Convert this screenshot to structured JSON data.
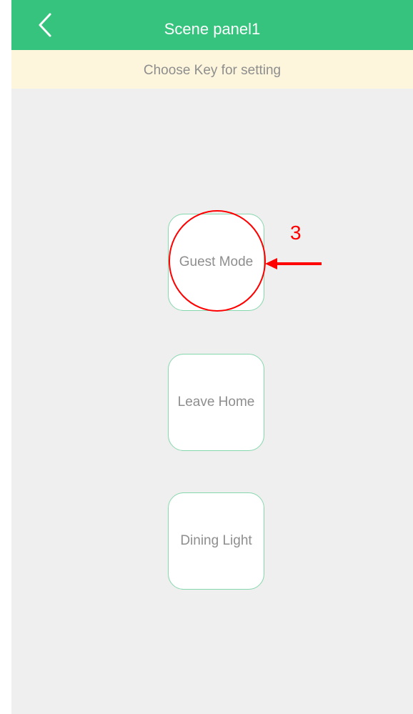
{
  "header": {
    "title": "Scene panel1",
    "back_icon": "chevron-left-icon"
  },
  "hint": {
    "text": "Choose Key for setting"
  },
  "keys": [
    {
      "label": "Guest Mode"
    },
    {
      "label": "Leave Home"
    },
    {
      "label": "Dining Light"
    }
  ],
  "annotation": {
    "step_number": "3",
    "color": "#ff0000"
  },
  "colors": {
    "nav_bar": "#35c37d",
    "hint_bar": "#fdf6dc",
    "background": "#efefef",
    "key_border": "#86d7ad",
    "key_text": "#8e8e8e"
  }
}
